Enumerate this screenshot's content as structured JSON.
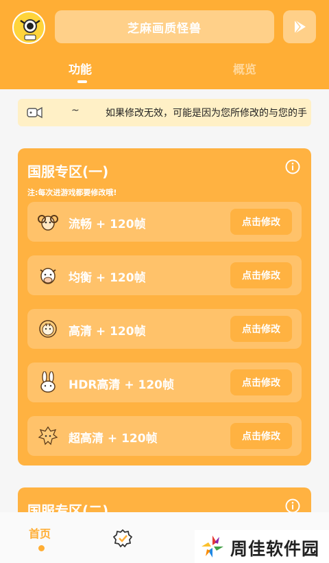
{
  "header": {
    "title": "芝麻画质怪兽",
    "tabs": [
      {
        "label": "功能",
        "active": true
      },
      {
        "label": "概览",
        "active": false
      }
    ]
  },
  "notice": {
    "dash": "~",
    "text": "如果修改无效，可能是因为您所修改的与您的手"
  },
  "section1": {
    "title": "国服专区(一)",
    "note": "注:每次进游戏都要修改哦!",
    "rows": [
      {
        "label": "流畅 + 120帧",
        "button": "点击修改",
        "icon": "ram-icon"
      },
      {
        "label": "均衡 + 120帧",
        "button": "点击修改",
        "icon": "cow-icon"
      },
      {
        "label": "高清 + 120帧",
        "button": "点击修改",
        "icon": "tiger-icon"
      },
      {
        "label": "HDR高清 + 120帧",
        "button": "点击修改",
        "icon": "rabbit-icon"
      },
      {
        "label": "超高清 + 120帧",
        "button": "点击修改",
        "icon": "dragon-icon"
      }
    ]
  },
  "section2": {
    "title": "国服专区(二)"
  },
  "bottom_nav": {
    "home": "首页"
  },
  "watermark": {
    "text": "周佳软件园"
  },
  "colors": {
    "primary": "#ffae35",
    "card": "#ffb241",
    "row": "#ffc26a",
    "notice_bg": "#fff0c6"
  }
}
